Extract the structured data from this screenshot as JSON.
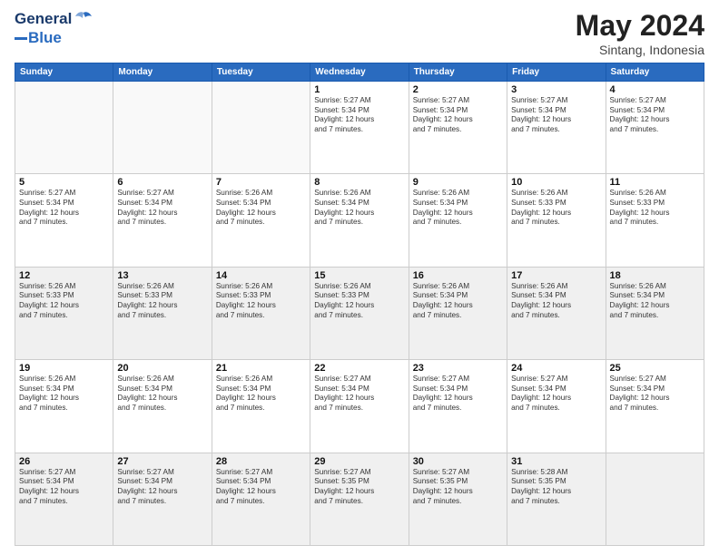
{
  "header": {
    "logo_line1": "General",
    "logo_line2": "Blue",
    "main_title": "May 2024",
    "subtitle": "Sintang, Indonesia"
  },
  "weekdays": [
    "Sunday",
    "Monday",
    "Tuesday",
    "Wednesday",
    "Thursday",
    "Friday",
    "Saturday"
  ],
  "rows": [
    {
      "shaded": false,
      "cells": [
        {
          "day": "",
          "info": ""
        },
        {
          "day": "",
          "info": ""
        },
        {
          "day": "",
          "info": ""
        },
        {
          "day": "1",
          "info": "Sunrise: 5:27 AM\nSunset: 5:34 PM\nDaylight: 12 hours\nand 7 minutes."
        },
        {
          "day": "2",
          "info": "Sunrise: 5:27 AM\nSunset: 5:34 PM\nDaylight: 12 hours\nand 7 minutes."
        },
        {
          "day": "3",
          "info": "Sunrise: 5:27 AM\nSunset: 5:34 PM\nDaylight: 12 hours\nand 7 minutes."
        },
        {
          "day": "4",
          "info": "Sunrise: 5:27 AM\nSunset: 5:34 PM\nDaylight: 12 hours\nand 7 minutes."
        }
      ]
    },
    {
      "shaded": false,
      "cells": [
        {
          "day": "5",
          "info": "Sunrise: 5:27 AM\nSunset: 5:34 PM\nDaylight: 12 hours\nand 7 minutes."
        },
        {
          "day": "6",
          "info": "Sunrise: 5:27 AM\nSunset: 5:34 PM\nDaylight: 12 hours\nand 7 minutes."
        },
        {
          "day": "7",
          "info": "Sunrise: 5:26 AM\nSunset: 5:34 PM\nDaylight: 12 hours\nand 7 minutes."
        },
        {
          "day": "8",
          "info": "Sunrise: 5:26 AM\nSunset: 5:34 PM\nDaylight: 12 hours\nand 7 minutes."
        },
        {
          "day": "9",
          "info": "Sunrise: 5:26 AM\nSunset: 5:34 PM\nDaylight: 12 hours\nand 7 minutes."
        },
        {
          "day": "10",
          "info": "Sunrise: 5:26 AM\nSunset: 5:33 PM\nDaylight: 12 hours\nand 7 minutes."
        },
        {
          "day": "11",
          "info": "Sunrise: 5:26 AM\nSunset: 5:33 PM\nDaylight: 12 hours\nand 7 minutes."
        }
      ]
    },
    {
      "shaded": true,
      "cells": [
        {
          "day": "12",
          "info": "Sunrise: 5:26 AM\nSunset: 5:33 PM\nDaylight: 12 hours\nand 7 minutes."
        },
        {
          "day": "13",
          "info": "Sunrise: 5:26 AM\nSunset: 5:33 PM\nDaylight: 12 hours\nand 7 minutes."
        },
        {
          "day": "14",
          "info": "Sunrise: 5:26 AM\nSunset: 5:33 PM\nDaylight: 12 hours\nand 7 minutes."
        },
        {
          "day": "15",
          "info": "Sunrise: 5:26 AM\nSunset: 5:33 PM\nDaylight: 12 hours\nand 7 minutes."
        },
        {
          "day": "16",
          "info": "Sunrise: 5:26 AM\nSunset: 5:34 PM\nDaylight: 12 hours\nand 7 minutes."
        },
        {
          "day": "17",
          "info": "Sunrise: 5:26 AM\nSunset: 5:34 PM\nDaylight: 12 hours\nand 7 minutes."
        },
        {
          "day": "18",
          "info": "Sunrise: 5:26 AM\nSunset: 5:34 PM\nDaylight: 12 hours\nand 7 minutes."
        }
      ]
    },
    {
      "shaded": false,
      "cells": [
        {
          "day": "19",
          "info": "Sunrise: 5:26 AM\nSunset: 5:34 PM\nDaylight: 12 hours\nand 7 minutes."
        },
        {
          "day": "20",
          "info": "Sunrise: 5:26 AM\nSunset: 5:34 PM\nDaylight: 12 hours\nand 7 minutes."
        },
        {
          "day": "21",
          "info": "Sunrise: 5:26 AM\nSunset: 5:34 PM\nDaylight: 12 hours\nand 7 minutes."
        },
        {
          "day": "22",
          "info": "Sunrise: 5:27 AM\nSunset: 5:34 PM\nDaylight: 12 hours\nand 7 minutes."
        },
        {
          "day": "23",
          "info": "Sunrise: 5:27 AM\nSunset: 5:34 PM\nDaylight: 12 hours\nand 7 minutes."
        },
        {
          "day": "24",
          "info": "Sunrise: 5:27 AM\nSunset: 5:34 PM\nDaylight: 12 hours\nand 7 minutes."
        },
        {
          "day": "25",
          "info": "Sunrise: 5:27 AM\nSunset: 5:34 PM\nDaylight: 12 hours\nand 7 minutes."
        }
      ]
    },
    {
      "shaded": true,
      "cells": [
        {
          "day": "26",
          "info": "Sunrise: 5:27 AM\nSunset: 5:34 PM\nDaylight: 12 hours\nand 7 minutes."
        },
        {
          "day": "27",
          "info": "Sunrise: 5:27 AM\nSunset: 5:34 PM\nDaylight: 12 hours\nand 7 minutes."
        },
        {
          "day": "28",
          "info": "Sunrise: 5:27 AM\nSunset: 5:34 PM\nDaylight: 12 hours\nand 7 minutes."
        },
        {
          "day": "29",
          "info": "Sunrise: 5:27 AM\nSunset: 5:35 PM\nDaylight: 12 hours\nand 7 minutes."
        },
        {
          "day": "30",
          "info": "Sunrise: 5:27 AM\nSunset: 5:35 PM\nDaylight: 12 hours\nand 7 minutes."
        },
        {
          "day": "31",
          "info": "Sunrise: 5:28 AM\nSunset: 5:35 PM\nDaylight: 12 hours\nand 7 minutes."
        },
        {
          "day": "",
          "info": ""
        }
      ]
    }
  ]
}
